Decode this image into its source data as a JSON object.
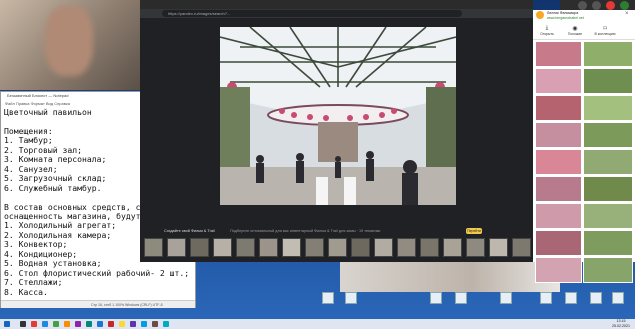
{
  "browser": {
    "url": "https://yandex.ru/images/search?...",
    "promo_title": "Создайте свой Фильм & Trail",
    "promo_text": "Подберите оптимальный для вас инвентарный Фильм & Trail для зимы · 19 тематики",
    "find_button": "Перейти",
    "thumbnail_count": 17
  },
  "panel": {
    "title": "Лиллик Фальмасра",
    "site": "www.bergamotrabel.net",
    "actions": [
      "Открыть",
      "Похожие",
      "В коллекцию"
    ]
  },
  "notepad": {
    "title": "Безымянный Блокнот — Notepad",
    "menu": "Файл  Правка  Формат  Вид  Справка",
    "lines": [
      "Цветочный павильон",
      "",
      "Помещения:",
      "1. Тамбур;",
      "2. Торговый зал;",
      "3. Комната персонала;",
      "4. Санузел;",
      "5. Загрузочный склад;",
      "6. Служебный тамбур.",
      "",
      "В состав основных средств, соста",
      "оснащенность магазина, будут вхо",
      "1. Холодильный агрегат;",
      "2. Холодильная камера;",
      "3. Конвектор;",
      "4. Кондиционер;",
      "5. Водная установка;",
      "6. Стол флористический рабочий- 2 шт.;",
      "7. Стеллажи;",
      "8. Касса."
    ],
    "status": "Стр 16, стлб 1   100%   Windows (CRLF)   UTF-8"
  },
  "taskbar": {
    "time": "13:15",
    "date": "25.02.2021"
  },
  "colors": {
    "desktop": "#1d4f9a",
    "accent_red": "#e53935",
    "accent_green": "#2e7d32",
    "promo_button": "#f2c94c"
  }
}
